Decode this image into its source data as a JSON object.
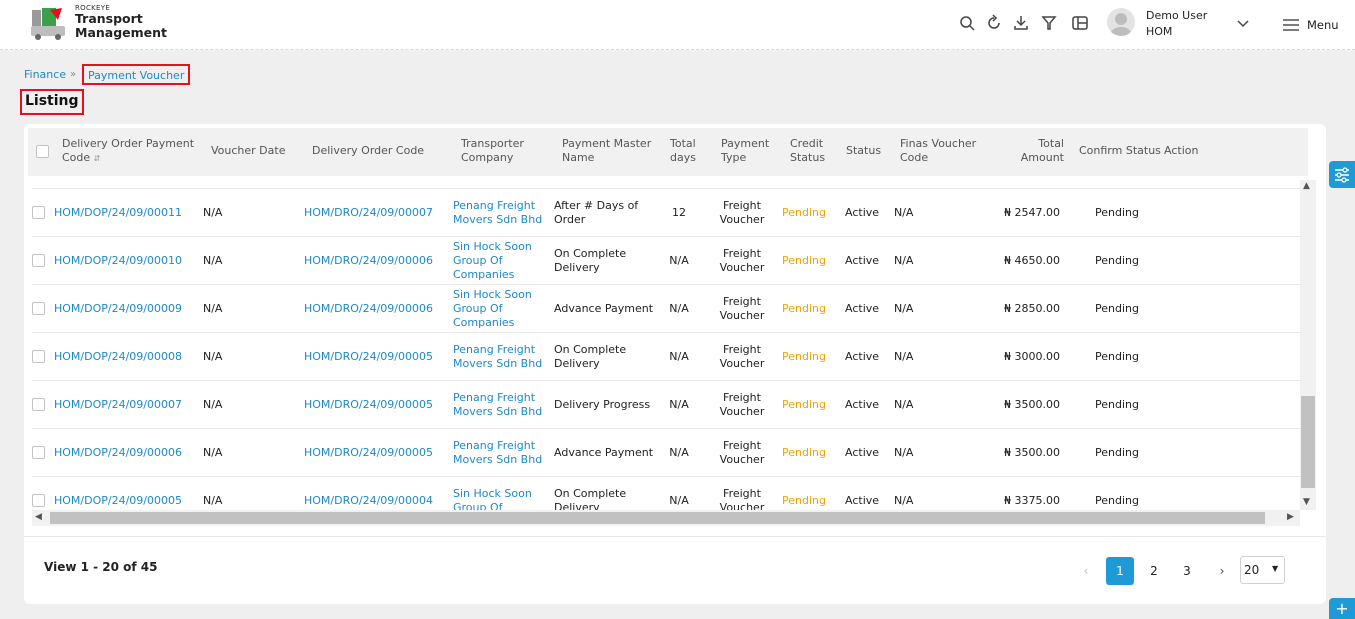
{
  "header": {
    "brand_small": "ROCKEYE",
    "brand_line1": "Transport",
    "brand_line2": "Management",
    "user_name": "Demo User",
    "user_branch": "HOM",
    "menu_label": "Menu"
  },
  "breadcrumb": {
    "parent": "Finance",
    "current": "Payment Voucher"
  },
  "page_title": "Listing",
  "table": {
    "columns": [
      "Delivery Order Payment Code",
      "Voucher Date",
      "Delivery Order Code",
      "Transporter Company",
      "Payment Master Name",
      "Total days",
      "Payment Type",
      "Credit Status",
      "Status",
      "Finas Voucher Code",
      "Total Amount",
      "Confirm Status",
      "Action"
    ],
    "rows": [
      {
        "code": "HOM/DOP/24/09/00011",
        "date": "N/A",
        "do_code": "HOM/DRO/24/09/00007",
        "transporter": [
          "Penang Freight",
          "Movers Sdn Bhd"
        ],
        "payment_master": [
          "After # Days of",
          "Order"
        ],
        "days": "12",
        "type": [
          "Freight",
          "Voucher"
        ],
        "credit": "Pending",
        "status": "Active",
        "finas": "N/A",
        "amount": "₦ 2547.00",
        "confirm": "Pending"
      },
      {
        "code": "HOM/DOP/24/09/00010",
        "date": "N/A",
        "do_code": "HOM/DRO/24/09/00006",
        "transporter": [
          "Sin Hock Soon",
          "Group Of",
          "Companies"
        ],
        "payment_master": [
          "On Complete",
          "Delivery"
        ],
        "days": "N/A",
        "type": [
          "Freight",
          "Voucher"
        ],
        "credit": "Pending",
        "status": "Active",
        "finas": "N/A",
        "amount": "₦ 4650.00",
        "confirm": "Pending"
      },
      {
        "code": "HOM/DOP/24/09/00009",
        "date": "N/A",
        "do_code": "HOM/DRO/24/09/00006",
        "transporter": [
          "Sin Hock Soon",
          "Group Of",
          "Companies"
        ],
        "payment_master": [
          "Advance Payment"
        ],
        "days": "N/A",
        "type": [
          "Freight",
          "Voucher"
        ],
        "credit": "Pending",
        "status": "Active",
        "finas": "N/A",
        "amount": "₦ 2850.00",
        "confirm": "Pending"
      },
      {
        "code": "HOM/DOP/24/09/00008",
        "date": "N/A",
        "do_code": "HOM/DRO/24/09/00005",
        "transporter": [
          "Penang Freight",
          "Movers Sdn Bhd"
        ],
        "payment_master": [
          "On Complete",
          "Delivery"
        ],
        "days": "N/A",
        "type": [
          "Freight",
          "Voucher"
        ],
        "credit": "Pending",
        "status": "Active",
        "finas": "N/A",
        "amount": "₦ 3000.00",
        "confirm": "Pending"
      },
      {
        "code": "HOM/DOP/24/09/00007",
        "date": "N/A",
        "do_code": "HOM/DRO/24/09/00005",
        "transporter": [
          "Penang Freight",
          "Movers Sdn Bhd"
        ],
        "payment_master": [
          "Delivery Progress"
        ],
        "days": "N/A",
        "type": [
          "Freight",
          "Voucher"
        ],
        "credit": "Pending",
        "status": "Active",
        "finas": "N/A",
        "amount": "₦ 3500.00",
        "confirm": "Pending"
      },
      {
        "code": "HOM/DOP/24/09/00006",
        "date": "N/A",
        "do_code": "HOM/DRO/24/09/00005",
        "transporter": [
          "Penang Freight",
          "Movers Sdn Bhd"
        ],
        "payment_master": [
          "Advance Payment"
        ],
        "days": "N/A",
        "type": [
          "Freight",
          "Voucher"
        ],
        "credit": "Pending",
        "status": "Active",
        "finas": "N/A",
        "amount": "₦ 3500.00",
        "confirm": "Pending"
      },
      {
        "code": "HOM/DOP/24/09/00005",
        "date": "N/A",
        "do_code": "HOM/DRO/24/09/00004",
        "transporter": [
          "Sin Hock Soon",
          "Group Of"
        ],
        "payment_master": [
          "On Complete",
          "Delivery"
        ],
        "days": "N/A",
        "type": [
          "Freight",
          "Voucher"
        ],
        "credit": "Pending",
        "status": "Active",
        "finas": "N/A",
        "amount": "₦ 3375.00",
        "confirm": "Pending"
      }
    ]
  },
  "pagination": {
    "summary": "View 1 - 20 of 45",
    "pages": [
      "1",
      "2",
      "3"
    ],
    "active_page": "1",
    "page_size": "20"
  },
  "colors": {
    "accent": "#1e9ad6",
    "link": "#1e88c7",
    "pending": "#f0a400",
    "highlight": "#e0131f"
  }
}
